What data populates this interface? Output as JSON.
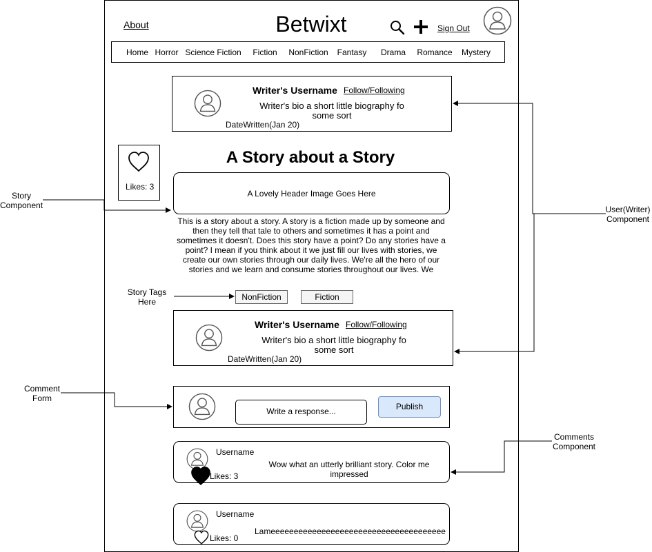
{
  "header": {
    "about_label": "About",
    "app_title": "Betwixt",
    "sign_out_label": "Sign Out"
  },
  "nav": {
    "items": [
      "Home",
      "Horror",
      "Science Fiction",
      "Fiction",
      "NonFiction",
      "Fantasy",
      "Drama",
      "Romance",
      "Mystery"
    ]
  },
  "writer_card": {
    "username": "Writer's Username",
    "follow_label": "Follow/Following",
    "bio": "Writer's bio a short little biography fo some sort",
    "date": "DateWritten(Jan 20)"
  },
  "story": {
    "likes_label": "Likes: 3",
    "title": "A Story about a Story",
    "header_image_label": "A Lovely Header Image Goes Here",
    "body": "This is a story about a story. A story is a fiction made up by someone and then they tell that tale to others and sometimes it has a point and sometimes it doesn't. Does this story have a point? Do any stories have a point? I mean if you think about it we just fill our lives with stories, we create our own stories through our daily lives. We're all the hero of our stories and we learn and consume stories throughout our lives. We",
    "tags": [
      "NonFiction",
      "Fiction"
    ]
  },
  "comment_form": {
    "placeholder": "Write a response...",
    "publish_label": "Publish"
  },
  "comments": [
    {
      "username": "Username",
      "likes": "Likes: 3",
      "text": "Wow what an utterly brilliant story. Color me impressed"
    },
    {
      "username": "Username",
      "likes": "Likes: 0",
      "text": "Lameeeeeeeeeeeeeeeeeeeeeeeeeeeeeeeeeeeeee"
    }
  ],
  "annotations": {
    "story_component": "Story Component",
    "story_tags": "Story Tags Here",
    "comment_form": "Comment Form",
    "user_component": "User(Writer) Component",
    "comments_component": "Comments Component"
  },
  "colors": {
    "publish_bg": "#dae8fc",
    "publish_border": "#6c8ebf",
    "tag_bg": "#f5f5f5",
    "avatar_stroke": "#555555"
  }
}
